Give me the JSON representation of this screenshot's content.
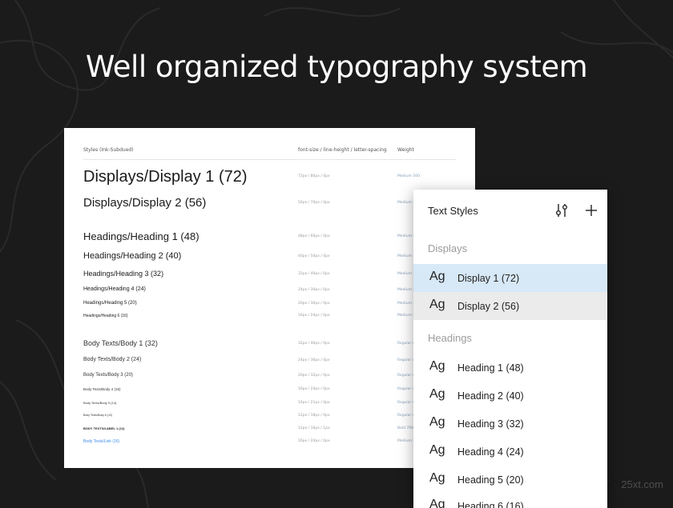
{
  "headline": "Well organized typography system",
  "doc": {
    "col_styles": "Styles (Ink-Subdued)",
    "col_spec": "font-size / line-height / letter-spacing",
    "col_weight": "Weight",
    "rows": [
      {
        "name": "Displays/Display 1 (72)",
        "spec": "72px / 80px / 0px",
        "weight": "Medium 500"
      },
      {
        "name": "Displays/Display 2 (56)",
        "spec": "56px / 70px / 0px",
        "weight": "Medium 5"
      },
      {
        "name": "Headings/Heading 1 (48)",
        "spec": "48px / 60px / 0px",
        "weight": "Medium 5"
      },
      {
        "name": "Headings/Heading 2 (40)",
        "spec": "40px / 50px / 0px",
        "weight": "Medium 5"
      },
      {
        "name": "Headings/Heading 3 (32)",
        "spec": "32px / 40px / 0px",
        "weight": "Medium 5"
      },
      {
        "name": "Headings/Heading 4 (24)",
        "spec": "24px / 30px / 0px",
        "weight": "Medium 5"
      },
      {
        "name": "Headings/Heading 5 (20)",
        "spec": "20px / 30px / 0px",
        "weight": "Medium 5"
      },
      {
        "name": "Headings/Heading 6 (16)",
        "spec": "16px / 24px / 0px",
        "weight": "Medium 5"
      },
      {
        "name": "Body Texts/Body 1 (32)",
        "spec": "32px / 40px / 0px",
        "weight": "Regular 4"
      },
      {
        "name": "Body Texts/Body 2 (24)",
        "spec": "24px / 36px / 0px",
        "weight": "Regular 4"
      },
      {
        "name": "Body Texts/Body 3 (20)",
        "spec": "20px / 32px / 0px",
        "weight": "Regular 4"
      },
      {
        "name": "Body Texts/Body 4 (16)",
        "spec": "16px / 24px / 0px",
        "weight": "Regular 4"
      },
      {
        "name": "Body Texts/Body 5 (14)",
        "spec": "14px / 21px / 0px",
        "weight": "Regular 4"
      },
      {
        "name": "Body Texts/Body 6 (12)",
        "spec": "12px / 18px / 0px",
        "weight": "Regular 4"
      },
      {
        "name": "BODY TEXTS/LABEL 1 (12)",
        "spec": "12px / 16px / 1px",
        "weight": "Bold 700"
      },
      {
        "name": "Body Texts/Link (16)",
        "spec": "16px / 24px / 0px",
        "weight": "Medium 5"
      }
    ]
  },
  "panel": {
    "title": "Text Styles",
    "icons": {
      "adjust": "sliders-icon",
      "add": "plus-icon"
    },
    "groups": {
      "displays": "Displays",
      "headings": "Headings"
    },
    "ag": "Ag",
    "display_items": [
      "Display 1 (72)",
      "Display 2 (56)"
    ],
    "heading_items": [
      "Heading 1 (48)",
      "Heading 2 (40)",
      "Heading 3 (32)",
      "Heading 4 (24)",
      "Heading 5 (20)",
      "Heading 6 (16)"
    ]
  },
  "watermark": "25xt.com"
}
